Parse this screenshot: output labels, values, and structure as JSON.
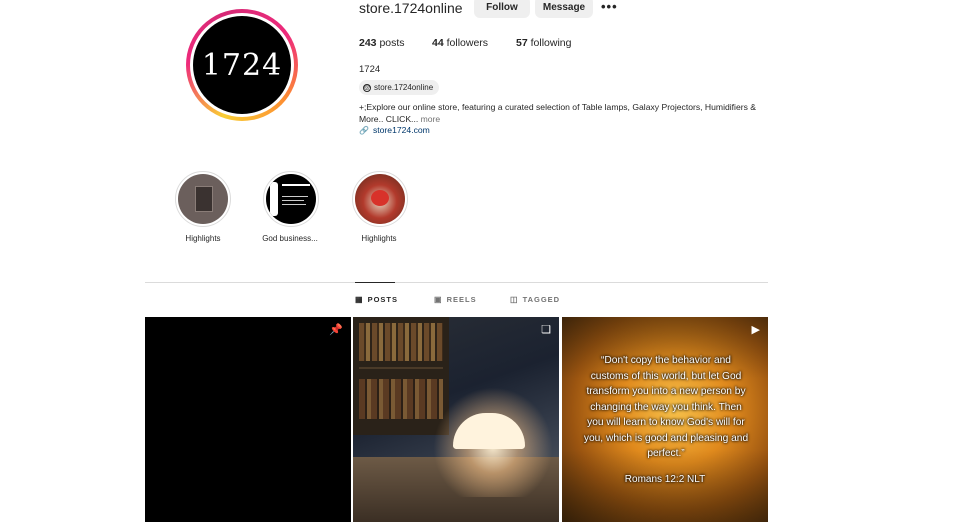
{
  "profile": {
    "username": "store.1724online",
    "avatar_text": "1724",
    "follow_label": "Follow",
    "message_label": "Message",
    "more_label": "•••",
    "posts_count": "243",
    "posts_label": "posts",
    "followers_count": "44",
    "followers_label": "followers",
    "following_count": "57",
    "following_label": "following",
    "full_name": "1724",
    "threads_handle": "store.1724online",
    "bio": "+;Explore our online store, featuring a curated selection of Table lamps, Galaxy Projectors, Humidifiers & More.. CLICK...",
    "bio_more": "more",
    "link": "store1724.com"
  },
  "highlights": [
    {
      "label": "Highlights"
    },
    {
      "label": "God business..."
    },
    {
      "label": "Highlights"
    }
  ],
  "tabs": [
    {
      "label": "POSTS",
      "icon": "grid-icon",
      "active": true
    },
    {
      "label": "REELS",
      "icon": "reels-icon",
      "active": false
    },
    {
      "label": "TAGGED",
      "icon": "tagged-icon",
      "active": false
    }
  ],
  "posts": [
    {
      "icon": "pin-icon"
    },
    {
      "icon": "carousel-icon"
    },
    {
      "icon": "reel-icon",
      "quote": "“Don't copy the behavior and customs of this world, but let God transform you into a new person by changing the way you think. Then you will learn to know God's will for you, which is good and pleasing and perfect.”",
      "reference": "Romans 12:2 NLT"
    }
  ],
  "colors": {
    "link": "#00376b",
    "button_bg": "#efefef",
    "divider": "#dbdbdb",
    "muted": "#737373"
  }
}
